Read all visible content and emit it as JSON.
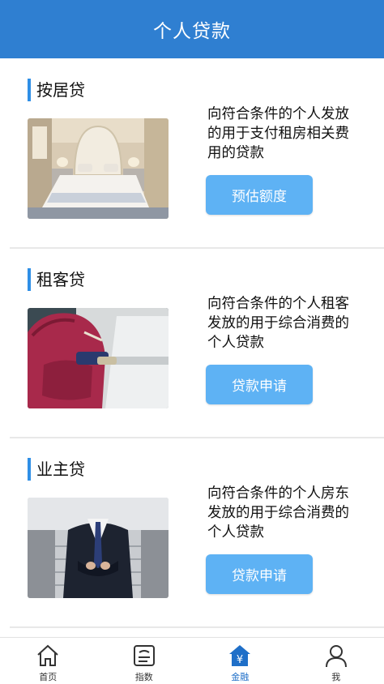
{
  "header": {
    "title": "个人贷款"
  },
  "cards": [
    {
      "title": "按居贷",
      "description": "向符合条件的个人发放的用于支付租房相关费用的贷款",
      "button_label": "预估额度",
      "image": "bedroom-photo"
    },
    {
      "title": "租客贷",
      "description": "向符合条件的个人租客发放的用于综合消费的个人贷款",
      "button_label": "贷款申请",
      "image": "backpack-photo"
    },
    {
      "title": "业主贷",
      "description": "向符合条件的个人房东发放的用于综合消费的个人贷款",
      "button_label": "贷款申请",
      "image": "businessman-photo"
    }
  ],
  "tabbar": {
    "items": [
      {
        "label": "首页",
        "icon": "home-icon",
        "active": false
      },
      {
        "label": "指数",
        "icon": "index-icon",
        "active": false
      },
      {
        "label": "金融",
        "icon": "finance-icon",
        "active": true
      },
      {
        "label": "我",
        "icon": "profile-icon",
        "active": false
      }
    ]
  },
  "colors": {
    "header_bg": "#2f7fd1",
    "accent": "#2f8fe6",
    "button_bg": "#5eb2f4",
    "active_tab": "#1f6fc8"
  }
}
